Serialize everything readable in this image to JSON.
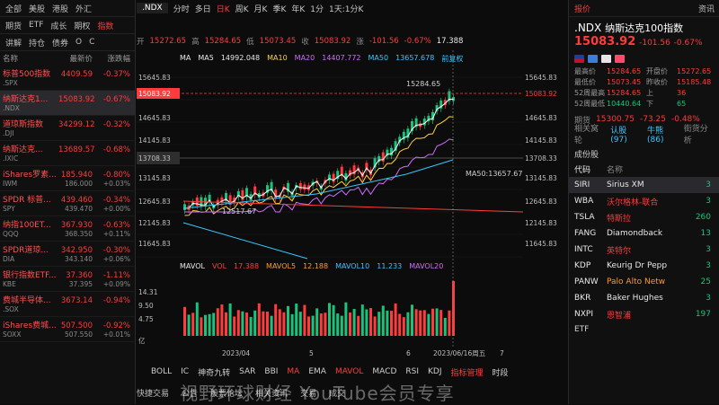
{
  "left": {
    "tabs1": [
      "全部",
      "美股",
      "港股",
      "外汇"
    ],
    "tabs2": [
      "期货",
      "ETF",
      "成长",
      "期权",
      "指数"
    ],
    "tabs3": [
      "讲解",
      "持仓",
      "债券",
      "O",
      "C"
    ],
    "cols": [
      "名称",
      "最新价",
      "涨跌幅"
    ],
    "rows": [
      {
        "name": "标普500指数",
        "symbol": ".SPX",
        "price": "4409.59",
        "change": "-0.37%",
        "price2": "",
        "change2": ""
      },
      {
        "name": "纳斯达克1...",
        "symbol": ".NDX",
        "price": "15083.92",
        "change": "-0.67%",
        "price2": "",
        "change2": ""
      },
      {
        "name": "道琼斯指数",
        "symbol": ".DJI",
        "price": "34299.12",
        "change": "-0.32%",
        "price2": "",
        "change2": ""
      },
      {
        "name": "纳斯达克...",
        "symbol": ".IXIC",
        "price": "13689.57",
        "change": "-0.68%",
        "price2": "",
        "change2": ""
      },
      {
        "name": "iShares罗素...",
        "symbol": "IWM",
        "price": "185.940",
        "change": "-0.80%",
        "price2": "186.000",
        "change2": "+0.03%"
      },
      {
        "name": "SPDR 标普...",
        "symbol": "SPY",
        "price": "439.460",
        "change": "-0.34%",
        "price2": "439.470",
        "change2": "+0.00%"
      },
      {
        "name": "纳指100ET...",
        "symbol": "QQQ",
        "price": "367.930",
        "change": "-0.63%",
        "price2": "368.350",
        "change2": "+0.11%"
      },
      {
        "name": "SPDR道琼...",
        "symbol": "DIA",
        "price": "342.950",
        "change": "-0.30%",
        "price2": "343.140",
        "change2": "+0.06%"
      },
      {
        "name": "银行指数ETF...",
        "symbol": "KBE",
        "price": "37.360",
        "change": "-1.11%",
        "price2": "37.395",
        "change2": "+0.09%"
      },
      {
        "name": "费城半导体...",
        "symbol": ".SOX",
        "price": "3673.14",
        "change": "-0.94%",
        "price2": "",
        "change2": ""
      },
      {
        "name": "iShares费城...",
        "symbol": "SOXX",
        "price": "507.500",
        "change": "-0.92%",
        "price2": "507.550",
        "change2": "+0.01%"
      }
    ]
  },
  "top": {
    "symbol": ".NDX",
    "periods": [
      "分时",
      "多日",
      "日K",
      "周K",
      "月K",
      "季K",
      "年K",
      "1分",
      "1天:1分K"
    ],
    "active": "日K"
  },
  "quote": {
    "open_label": "开",
    "open": "15272.65",
    "high_label": "高",
    "high": "15284.65",
    "low_label": "低",
    "low": "15073.45",
    "close_label": "收",
    "close": "15083.92",
    "chg_label": "涨",
    "chg": "-101.56",
    "pct": "-0.67%",
    "extra": "17.388"
  },
  "ma": {
    "label": "MA",
    "ma5_label": "MA5",
    "ma5": "14992.048",
    "ma10_label": "MA10",
    "ma20_label": "MA20",
    "ma20": "14407.772",
    "ma50_label": "MA50",
    "ma50": "13657.678",
    "fq": "前复权"
  },
  "axis": {
    "y": [
      "15645.83",
      "15083.92",
      "14645.83",
      "14145.83",
      "13708.33",
      "13145.83",
      "12645.83",
      "12145.83",
      "11645.83"
    ],
    "x": [
      "2023/04",
      "5",
      "6",
      "2023/06/16周五",
      "7"
    ],
    "high_label": "15284.65",
    "low_label": "12517.67",
    "ma50_tip": "MA50:13657.67",
    "vol_y": [
      "14.31",
      "9.50",
      "4.75",
      "亿"
    ]
  },
  "vol": {
    "label": "MAVOL",
    "vol_label": "VOL",
    "vol": "17.388",
    "mavol5_label": "MAVOL5",
    "mavol5": "12.188",
    "mavol10_label": "MAVOL10",
    "mavol10": "11.233",
    "mavol20_label": "MAVOL20"
  },
  "indicators": [
    "BOLL",
    "IC",
    "神奇九转",
    "SAR",
    "BBI",
    "MA",
    "EMA",
    "MAVOL",
    "MACD",
    "RSI",
    "KDJ",
    "指标管理",
    "时段"
  ],
  "bottom": [
    "快捷交易",
    "公告",
    "股票论坛",
    "相关资讯",
    "交易",
    "成交"
  ],
  "right": {
    "tabs": [
      "报价",
      "资讯"
    ],
    "code": ".NDX",
    "name": "纳斯达克100指数",
    "price": "15083.92",
    "chg": "-101.56",
    "pct": "-0.67%",
    "stats": [
      {
        "k": "最高价",
        "v": "15284.65",
        "k2": "开盘价",
        "v2": "15272.65"
      },
      {
        "k": "最低价",
        "v": "15073.45",
        "k2": "昨收价",
        "v2": "15185.48"
      },
      {
        "k": "52周最高",
        "v": "15284.65",
        "k2": "上",
        "v2": "36"
      },
      {
        "k": "52周最低",
        "v": "10440.64",
        "k2": "下",
        "v2": "65"
      }
    ],
    "futures_label": "期货",
    "futures_price": "15300.75",
    "futures_chg": "-73.25",
    "futures_pct": "-0.48%",
    "links": [
      "相关窝轮",
      "认股(97)",
      "牛熊(86)",
      "街货分析"
    ],
    "const_label": "成份股",
    "const_cols": [
      "代码",
      "名称"
    ],
    "constituents": [
      {
        "code": "SIRI",
        "name": "Sirius XM",
        "val": "3"
      },
      {
        "code": "WBA",
        "name": "沃尔格林-联合",
        "val": "3"
      },
      {
        "code": "TSLA",
        "name": "特斯拉",
        "val": "260"
      },
      {
        "code": "FANG",
        "name": "Diamondback",
        "val": "13"
      },
      {
        "code": "INTC",
        "name": "英特尔",
        "val": "3"
      },
      {
        "code": "KDP",
        "name": "Keurig Dr Pepp",
        "val": "3"
      },
      {
        "code": "PANW",
        "name": "Palo Alto Netw",
        "val": "25"
      },
      {
        "code": "BKR",
        "name": "Baker Hughes",
        "val": "3"
      },
      {
        "code": "NXPI",
        "name": "恩智浦",
        "val": "197"
      }
    ],
    "etf_label": "ETF"
  },
  "watermark": "视野环球财经 YouTube会员专享",
  "colors": {
    "up": "#ff3b3b",
    "down": "#19c37d",
    "ma5": "#ffffff",
    "ma10": "#ffd23a",
    "ma20": "#d06bff",
    "ma50": "#39c6ff"
  }
}
